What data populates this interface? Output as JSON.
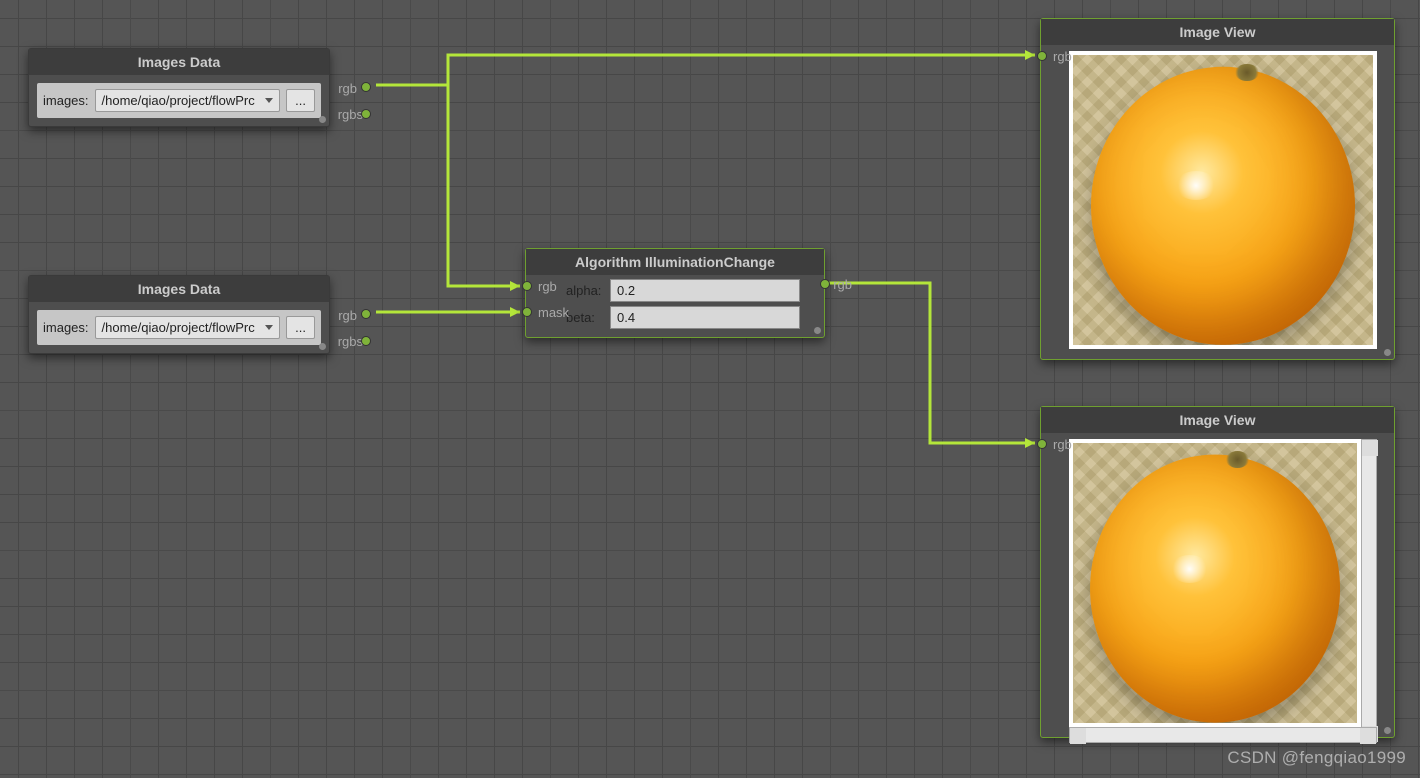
{
  "nodes": {
    "imagesData1": {
      "title": "Images Data",
      "label": "images:",
      "path": "/home/qiao/project/flowPrc",
      "browse": "...",
      "ports": {
        "rgb": "rgb",
        "rgbs": "rgbs"
      }
    },
    "imagesData2": {
      "title": "Images Data",
      "label": "images:",
      "path": "/home/qiao/project/flowPrc",
      "browse": "...",
      "ports": {
        "rgb": "rgb",
        "rgbs": "rgbs"
      }
    },
    "algorithm": {
      "title": "Algorithm IlluminationChange",
      "alpha_label": "alpha:",
      "alpha": "0.2",
      "beta_label": "beta:",
      "beta": "0.4",
      "ports": {
        "in_rgb": "rgb",
        "in_mask": "mask",
        "out_rgb": "rgb"
      }
    },
    "imageView1": {
      "title": "Image View",
      "ports": {
        "rgb": "rgb"
      }
    },
    "imageView2": {
      "title": "Image View",
      "ports": {
        "rgb": "rgb"
      }
    }
  },
  "colors": {
    "connection": "#b4e63a",
    "port": "#7fb33a",
    "node_border_selected": "#6fa030"
  },
  "watermark": "CSDN @fengqiao1999"
}
